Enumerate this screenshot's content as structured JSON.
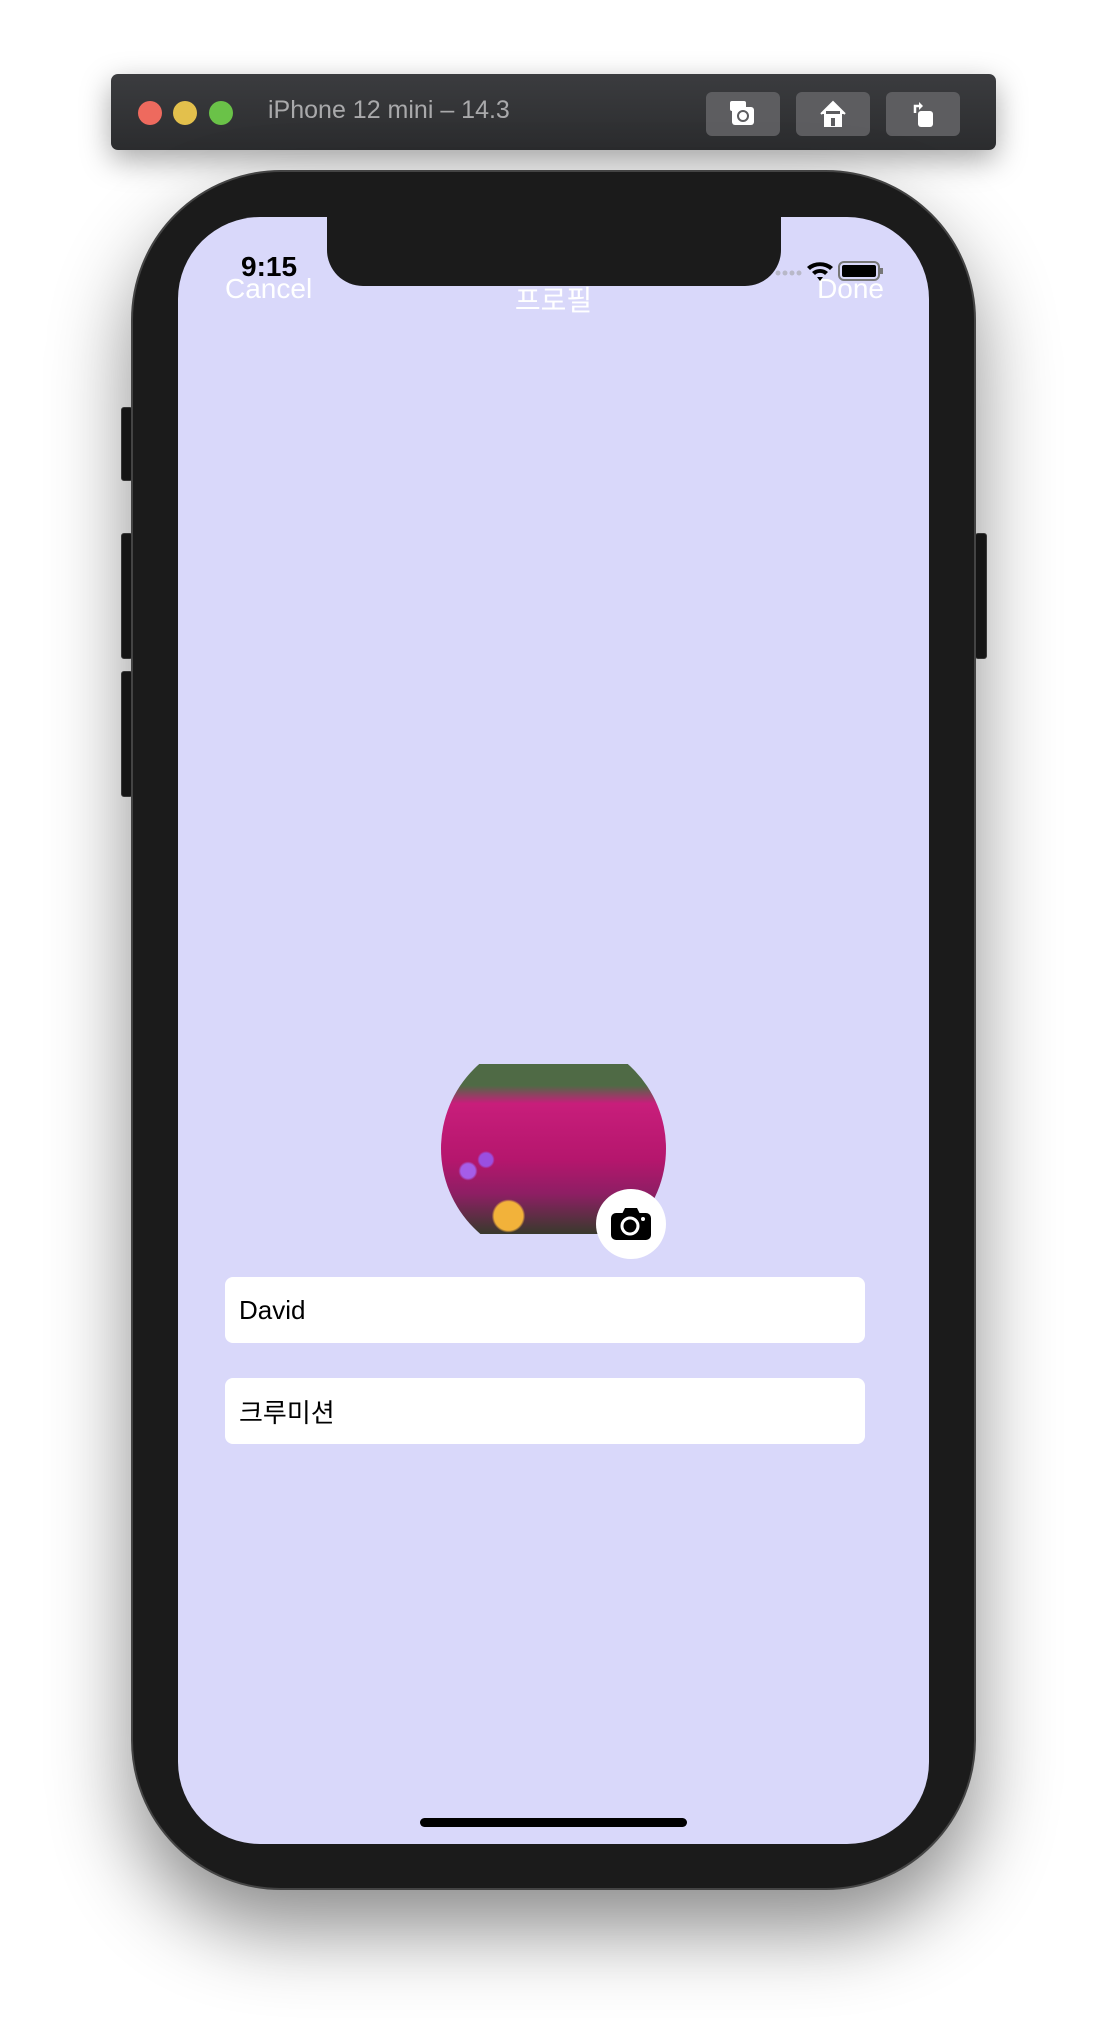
{
  "window": {
    "title": "iPhone 12 mini – 14.3",
    "buttons": [
      "screenshot",
      "home",
      "rotate"
    ]
  },
  "status_bar": {
    "time": "9:15"
  },
  "nav": {
    "cancel": "Cancel",
    "title": "프로필",
    "done": "Done"
  },
  "profile": {
    "name": "David",
    "status": "크루미션"
  },
  "colors": {
    "screen_bg": "#d9d8fa",
    "close": "#ee6a5e",
    "minimize": "#e3c04c",
    "zoom": "#6ac248"
  }
}
